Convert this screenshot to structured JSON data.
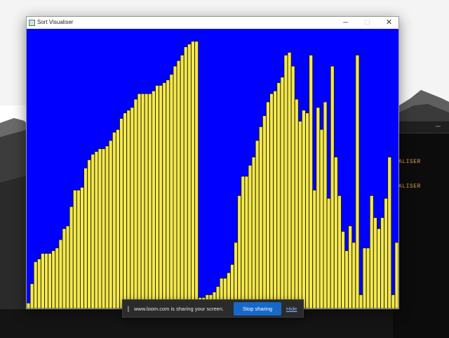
{
  "window": {
    "title": "Sort Visualiser",
    "controls": {
      "minimize": "─",
      "maximize": "☐",
      "close": "✕"
    }
  },
  "colors": {
    "canvas_background": "#0000ff",
    "bar_fill": "#f5e94a",
    "bar_outline": "#1a1a1a"
  },
  "visualization": {
    "max_value": 100,
    "bar_values": [
      2,
      9,
      17,
      18,
      20,
      20,
      20,
      21,
      22,
      25,
      29,
      30,
      37,
      43,
      43,
      44,
      51,
      54,
      56,
      57,
      58,
      58,
      59,
      61,
      64,
      65,
      69,
      71,
      72,
      73,
      76,
      78,
      78,
      78,
      78,
      79,
      81,
      81,
      82,
      83,
      85,
      88,
      90,
      92,
      95,
      96,
      97,
      97,
      4,
      4,
      5,
      5,
      6,
      8,
      11,
      11,
      13,
      16,
      24,
      41,
      48,
      48,
      52,
      55,
      61,
      66,
      70,
      75,
      78,
      79,
      82,
      84,
      92,
      93,
      88,
      76,
      68,
      72,
      71,
      92,
      43,
      73,
      65,
      75,
      40,
      88,
      55,
      41,
      28,
      21,
      30,
      24,
      92,
      5,
      22,
      22,
      41,
      33,
      29,
      33,
      40,
      55,
      5,
      24
    ]
  },
  "terminal": {
    "lines": [
      "ALISER",
      "ALISER"
    ],
    "minimize": "─"
  },
  "loom": {
    "handle": "||",
    "message": "www.loom.com is sharing your screen.",
    "stop_label": "Stop sharing",
    "hide_label": "Hide"
  }
}
